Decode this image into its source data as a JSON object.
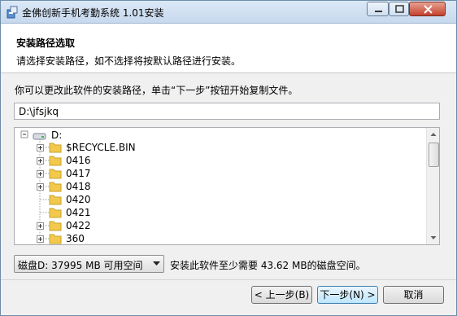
{
  "window": {
    "title": "金佛创新手机考勤系统 1.01安装"
  },
  "header": {
    "title": "安装路径选取",
    "subtitle": "请选择安装路径，如不选择将按默认路径进行安装。"
  },
  "content": {
    "description": "你可以更改此软件的安装路径，单击“下一步”按钮开始复制文件。",
    "install_path": "D:\\jfsjkq",
    "tree": {
      "root": "D:",
      "items": [
        "$RECYCLE.BIN",
        "0416",
        "0417",
        "0418",
        "0420",
        "0421",
        "0422",
        "360"
      ]
    },
    "disk_select_value": "磁盘D:   37995 MB 可用空间",
    "space_note": "安装此软件至少需要 43.62 MB的磁盘空间。"
  },
  "buttons": {
    "back": "< 上一步(B)",
    "next": "下一步(N) >",
    "cancel": "取消"
  },
  "colors": {
    "title_bar": "#c7d9ee",
    "close_button": "#c4402d",
    "folder": "#f2c94c"
  }
}
